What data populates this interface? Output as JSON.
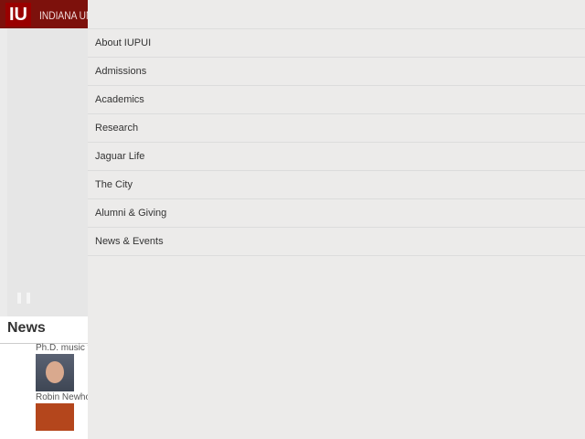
{
  "header": {
    "logo": "IU",
    "title": "INDIANA UNIVERSITY"
  },
  "menu": [
    {
      "label": "About IUPUI"
    },
    {
      "label": "Admissions"
    },
    {
      "label": "Academics"
    },
    {
      "label": "Research"
    },
    {
      "label": "Jaguar Life"
    },
    {
      "label": "The City"
    },
    {
      "label": "Alumni & Giving"
    },
    {
      "label": "News & Events"
    }
  ],
  "hero": {
    "pause": "❚❚"
  },
  "news": {
    "heading": "News",
    "items": [
      {
        "title": "Ph.D. music therapy"
      },
      {
        "title": "Robin Newhouse"
      }
    ]
  }
}
